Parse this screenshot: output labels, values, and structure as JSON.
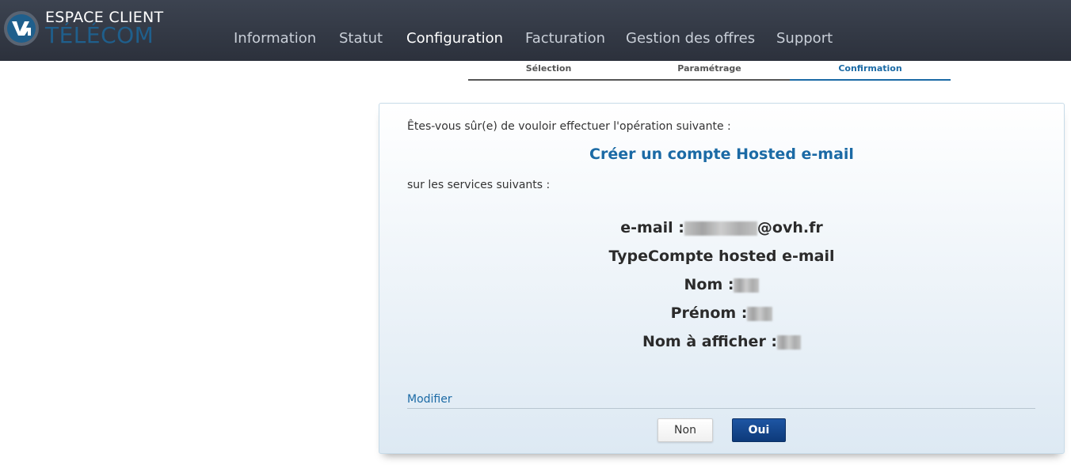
{
  "header": {
    "brand_line1": "ESPACE CLIENT",
    "brand_line2": "TÉLÉCOM",
    "nav": [
      "Information",
      "Statut",
      "Configuration",
      "Facturation",
      "Gestion des offres",
      "Support"
    ],
    "active_nav": "Configuration"
  },
  "steps": {
    "items": [
      "Sélection",
      "Paramétrage",
      "Confirmation"
    ],
    "active": "Confirmation"
  },
  "confirm": {
    "question": "Êtes-vous sûr(e) de vouloir effectuer l'opération suivante :",
    "operation": "Créer un compte Hosted e-mail",
    "services_label": "sur les services suivants :",
    "email_label": "e-mail :",
    "email_domain": "@ovh.fr",
    "type_line": "TypeCompte hosted e-mail",
    "nom_label": "Nom :",
    "prenom_label": "Prénom :",
    "nom_afficher_label": "Nom à afficher :",
    "modify_link": "Modifier",
    "no_button": "Non",
    "yes_button": "Oui"
  },
  "colors": {
    "topbar": "#353b47",
    "accent": "#1b6aa5",
    "primary_button": "#0d3a7a"
  }
}
